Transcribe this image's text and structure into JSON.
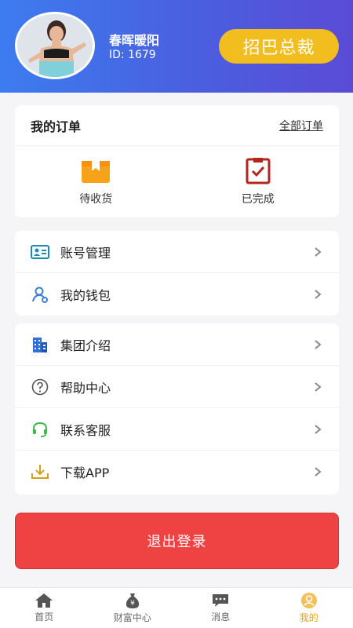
{
  "profile": {
    "name": "春晖暖阳",
    "id_text": "ID: 1679",
    "rank": "招巴总裁"
  },
  "orders": {
    "title": "我的订单",
    "all_link": "全部订单",
    "items": [
      {
        "label": "待收货",
        "icon": "package-icon",
        "color": "#f7a21b"
      },
      {
        "label": "已完成",
        "icon": "check-clipboard-icon",
        "color": "#b3261e"
      }
    ]
  },
  "menu1": [
    {
      "label": "账号管理",
      "icon": "id-card-icon",
      "color": "#1a8bb5"
    },
    {
      "label": "我的钱包",
      "icon": "wallet-user-icon",
      "color": "#3b7fd1"
    }
  ],
  "menu2": [
    {
      "label": "集团介绍",
      "icon": "building-icon",
      "color": "#2f6fd6"
    },
    {
      "label": "帮助中心",
      "icon": "help-icon",
      "color": "#555555"
    },
    {
      "label": "联系客服",
      "icon": "headset-icon",
      "color": "#3bb84a"
    },
    {
      "label": "下载APP",
      "icon": "download-icon",
      "color": "#d4a017"
    }
  ],
  "logout": {
    "label": "退出登录"
  },
  "tabs": [
    {
      "label": "首页",
      "icon": "home-icon"
    },
    {
      "label": "财富中心",
      "icon": "money-bag-icon"
    },
    {
      "label": "消息",
      "icon": "message-icon"
    },
    {
      "label": "我的",
      "icon": "profile-icon",
      "active": true
    }
  ],
  "colors": {
    "header_start": "#3d7cf0",
    "header_end": "#5a4bd6",
    "badge": "#f2bd1f",
    "logout": "#ef4242",
    "tab_active": "#e8a21a"
  }
}
